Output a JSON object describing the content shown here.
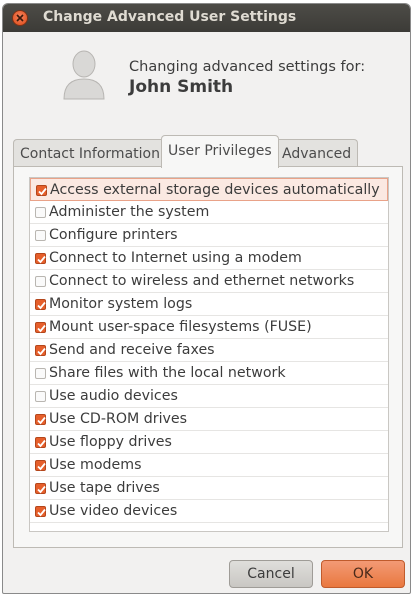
{
  "window": {
    "title": "Change Advanced User Settings"
  },
  "header": {
    "line1": "Changing advanced settings for:",
    "user_name": "John Smith",
    "avatar_icon": "user-silhouette-icon"
  },
  "tabs": [
    {
      "label": "Contact Information",
      "active": false
    },
    {
      "label": "User Privileges",
      "active": true
    },
    {
      "label": "Advanced",
      "active": false
    }
  ],
  "privileges": [
    {
      "label": "Access external storage devices automatically",
      "checked": true,
      "selected": true
    },
    {
      "label": "Administer the system",
      "checked": false
    },
    {
      "label": "Configure printers",
      "checked": false
    },
    {
      "label": "Connect to Internet using a modem",
      "checked": true
    },
    {
      "label": "Connect to wireless and ethernet networks",
      "checked": false
    },
    {
      "label": "Monitor system logs",
      "checked": true
    },
    {
      "label": "Mount user-space filesystems (FUSE)",
      "checked": true
    },
    {
      "label": "Send and receive faxes",
      "checked": true
    },
    {
      "label": "Share files with the local network",
      "checked": false
    },
    {
      "label": "Use audio devices",
      "checked": false
    },
    {
      "label": "Use CD-ROM drives",
      "checked": true
    },
    {
      "label": "Use floppy drives",
      "checked": true
    },
    {
      "label": "Use modems",
      "checked": true
    },
    {
      "label": "Use tape drives",
      "checked": true
    },
    {
      "label": "Use video devices",
      "checked": true
    }
  ],
  "buttons": {
    "cancel": "Cancel",
    "ok": "OK"
  },
  "colors": {
    "accent": "#e65f2b",
    "titlebar": "#3c3b37"
  }
}
